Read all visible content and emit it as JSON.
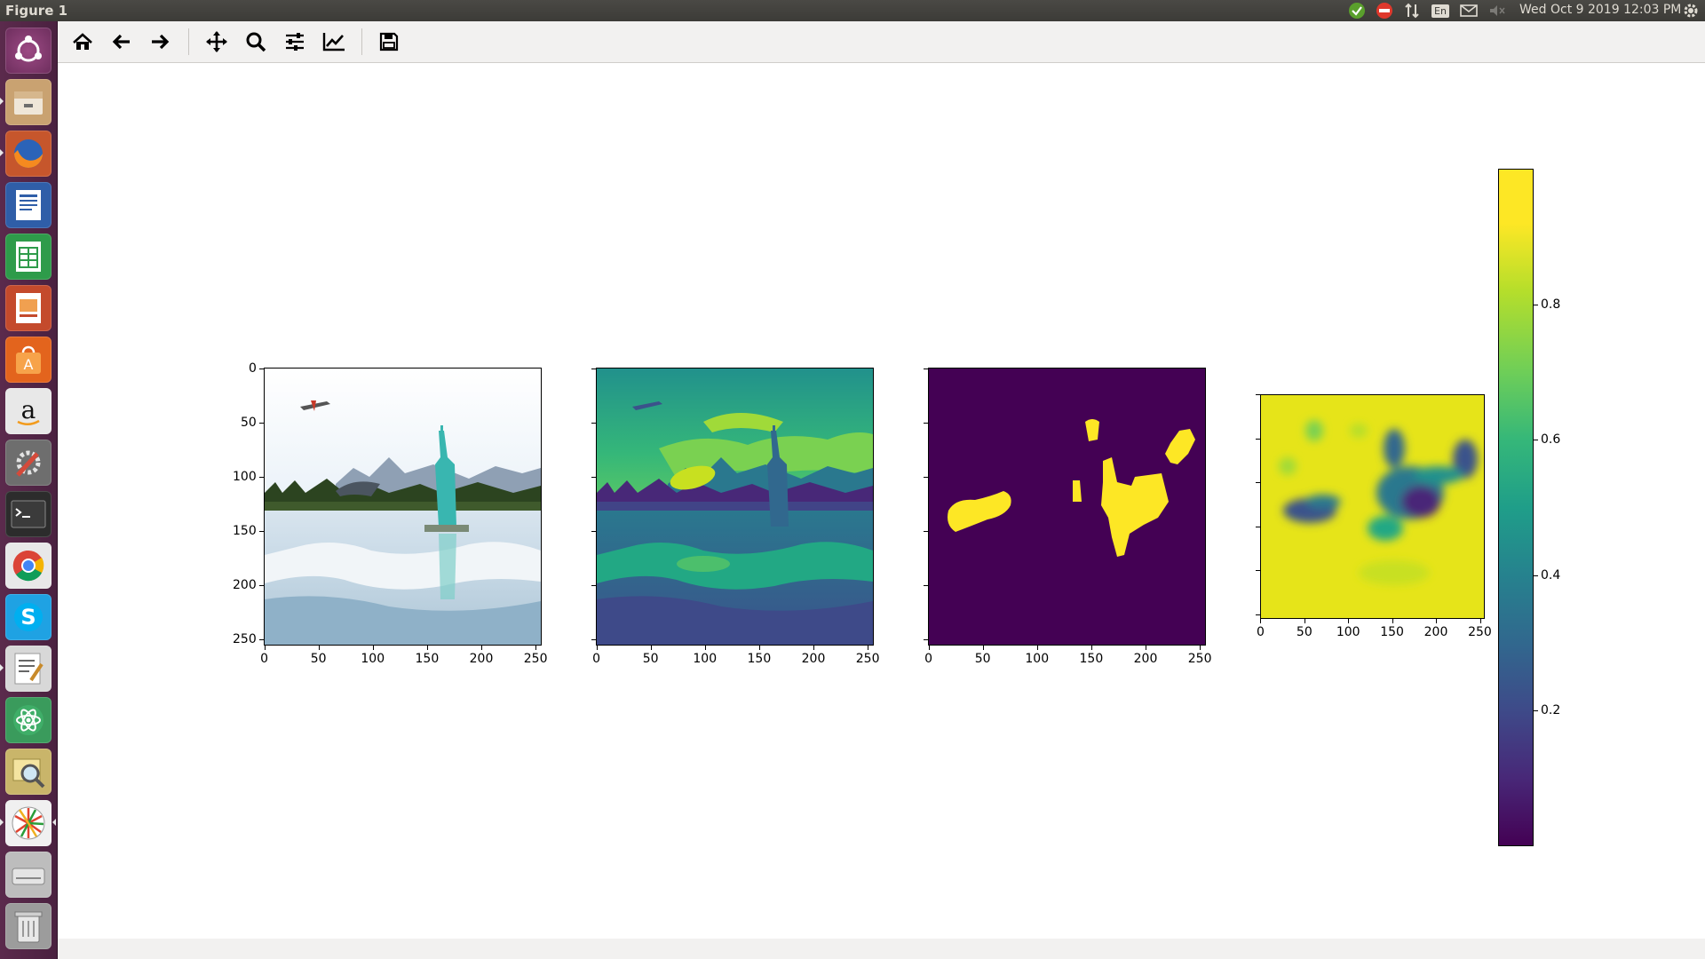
{
  "window": {
    "title": "Figure 1"
  },
  "top_panel": {
    "clock": "Wed Oct  9 2019 12:03 PM",
    "keyboard_layout": "En",
    "tray_icons": [
      "update-ok-icon",
      "no-entry-icon",
      "network-arrows-icon",
      "keyboard-icon",
      "mail-icon",
      "volume-muted-icon",
      "settings-gear-icon"
    ]
  },
  "launcher": {
    "items": [
      "ubuntu-dash",
      "files",
      "firefox",
      "libreoffice-writer",
      "libreoffice-calc",
      "libreoffice-impress",
      "software-center",
      "amazon",
      "system-settings",
      "terminal",
      "chrome",
      "skype",
      "text-editor",
      "atom",
      "image-viewer",
      "pinwheel-app",
      "disk-drive",
      "trash"
    ]
  },
  "toolbar": {
    "buttons": [
      "home",
      "back",
      "forward",
      "pan",
      "zoom",
      "configure-subplots",
      "edit-axes",
      "save"
    ]
  },
  "figure": {
    "axes1": {
      "xticks": [
        "0",
        "50",
        "100",
        "150",
        "200",
        "250"
      ],
      "yticks": [
        "0",
        "50",
        "100",
        "150",
        "200",
        "250"
      ]
    },
    "axes2": {
      "xticks": [
        "0",
        "50",
        "100",
        "150",
        "200",
        "250"
      ]
    },
    "axes3": {
      "xticks": [
        "0",
        "50",
        "100",
        "150",
        "200",
        "250"
      ]
    },
    "axes4": {
      "xticks": [
        "0",
        "50",
        "100",
        "150",
        "200",
        "250"
      ]
    },
    "colorbar": {
      "ticks": [
        "0.8",
        "0.6",
        "0.4",
        "0.2"
      ],
      "colormap": "viridis",
      "colors": [
        "#440154",
        "#3b528b",
        "#21918c",
        "#5ec962",
        "#fde725"
      ]
    }
  }
}
